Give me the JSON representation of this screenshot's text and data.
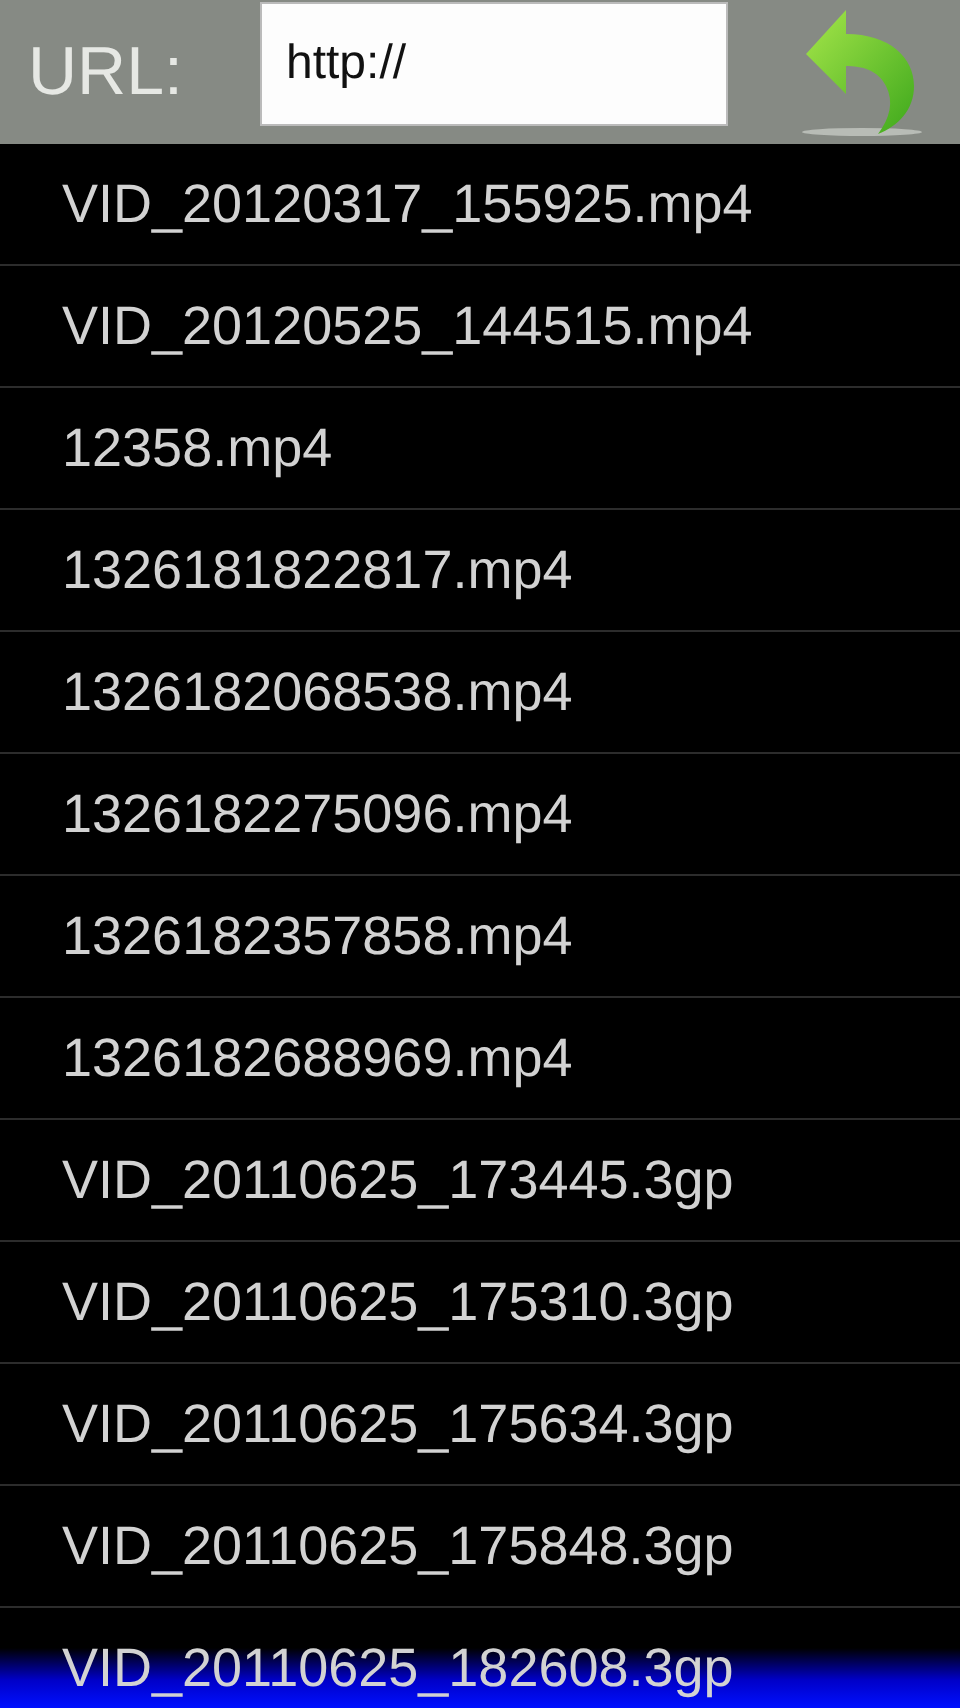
{
  "header": {
    "label": "URL:",
    "url_field": {
      "value": "http://"
    }
  },
  "files": [
    "VID_20120317_155925.mp4",
    "VID_20120525_144515.mp4",
    "12358.mp4",
    "1326181822817.mp4",
    "1326182068538.mp4",
    "1326182275096.mp4",
    "1326182357858.mp4",
    "1326182688969.mp4",
    "VID_20110625_173445.3gp",
    "VID_20110625_175310.3gp",
    "VID_20110625_175634.3gp",
    "VID_20110625_175848.3gp",
    "VID_20110625_182608.3gp"
  ]
}
